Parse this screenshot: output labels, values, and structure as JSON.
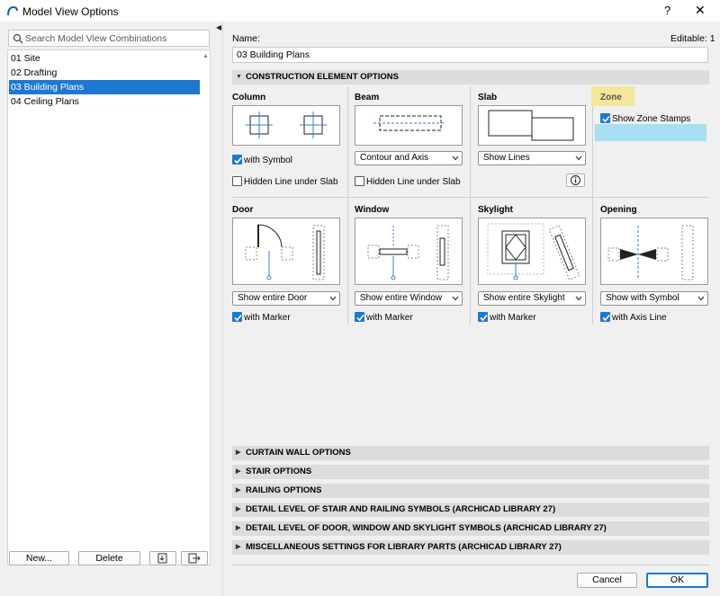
{
  "window": {
    "title": "Model View Options",
    "help": "?",
    "close": "✕"
  },
  "search": {
    "placeholder": "Search Model View Combinations"
  },
  "list": [
    {
      "label": "01 Site",
      "selected": false
    },
    {
      "label": "02 Drafting",
      "selected": false
    },
    {
      "label": "03 Building Plans",
      "selected": true
    },
    {
      "label": "04 Ceiling Plans",
      "selected": false
    }
  ],
  "left_buttons": {
    "new": "New...",
    "delete": "Delete"
  },
  "name": {
    "label": "Name:",
    "value": "03 Building Plans",
    "editable": "Editable: 1"
  },
  "construction_header": "CONSTRUCTION ELEMENT OPTIONS",
  "column": {
    "title": "Column",
    "with_symbol": "with Symbol",
    "hidden_line": "Hidden Line under Slab",
    "with_symbol_checked": true,
    "hidden_line_checked": false
  },
  "beam": {
    "title": "Beam",
    "dropdown": "Contour and Axis",
    "hidden_line": "Hidden Line under Slab",
    "hidden_line_checked": false
  },
  "slab": {
    "title": "Slab",
    "dropdown": "Show Lines"
  },
  "zone": {
    "title": "Zone",
    "show_stamps": "Show Zone Stamps",
    "show_stamps_checked": true
  },
  "door": {
    "title": "Door",
    "dropdown": "Show entire Door",
    "marker": "with Marker",
    "marker_checked": true
  },
  "window_el": {
    "title": "Window",
    "dropdown": "Show entire Window",
    "marker": "with Marker",
    "marker_checked": true
  },
  "skylight": {
    "title": "Skylight",
    "dropdown": "Show entire Skylight",
    "marker": "with Marker",
    "marker_checked": true
  },
  "opening": {
    "title": "Opening",
    "dropdown": "Show with Symbol",
    "axis_line": "with Axis Line",
    "axis_line_checked": true
  },
  "collapsed_sections": [
    "CURTAIN WALL OPTIONS",
    "STAIR OPTIONS",
    "RAILING OPTIONS",
    "DETAIL LEVEL OF STAIR AND RAILING SYMBOLS (ARCHICAD LIBRARY 27)",
    "DETAIL LEVEL OF DOOR, WINDOW AND SKYLIGHT SYMBOLS (ARCHICAD LIBRARY 27)",
    "MISCELLANEOUS SETTINGS FOR LIBRARY PARTS (ARCHICAD LIBRARY 27)"
  ],
  "footer": {
    "cancel": "Cancel",
    "ok": "OK"
  },
  "colors": {
    "accent": "#1e78d2",
    "zone_highlight": "#f6e69a",
    "zone_blue": "#a9ddf2"
  }
}
